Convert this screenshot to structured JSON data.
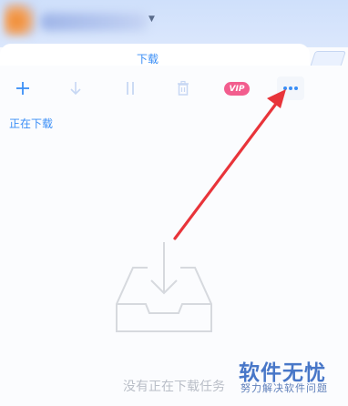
{
  "window": {
    "tab_title": "下载"
  },
  "toolbar": {
    "buttons": [
      {
        "name": "add",
        "icon": "plus-icon"
      },
      {
        "name": "start",
        "icon": "download-arrow-icon"
      },
      {
        "name": "pause",
        "icon": "pause-icon"
      },
      {
        "name": "delete",
        "icon": "trash-icon"
      },
      {
        "name": "vip",
        "label": "VIP"
      },
      {
        "name": "more",
        "icon": "more-dots-icon"
      }
    ],
    "vip_label": "VIP"
  },
  "section": {
    "label": "正在下载"
  },
  "empty_state": {
    "icon": "inbox-download-icon",
    "text": "没有正在下载任务"
  },
  "watermark": {
    "title": "软件无忧",
    "subtitle": "努力解决软件问题"
  },
  "colors": {
    "accent": "#3a8ef6",
    "vip": "#f25d8e",
    "annotation_arrow": "#e8343a"
  }
}
